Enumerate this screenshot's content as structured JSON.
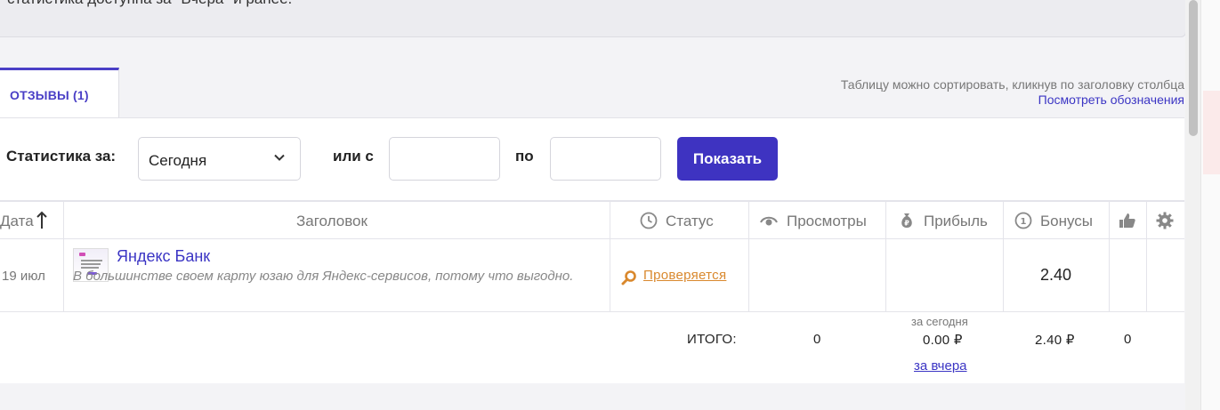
{
  "notice": {
    "text": "статистика доступна за \"Вчера\" и ранее."
  },
  "tabs": [
    {
      "label": "ОТЗЫВЫ (1)"
    }
  ],
  "hint": {
    "sort_text": "Таблицу можно сортировать, кликнув по заголовку столбца",
    "legend_link": "Посмотреть обозначения"
  },
  "filter": {
    "label": "Статистика за:",
    "period_value": "Сегодня",
    "or_from_label": "или с",
    "to_label": "по",
    "date_from_value": "",
    "date_to_value": "",
    "show_button": "Показать"
  },
  "table": {
    "headers": {
      "date": "Дата",
      "title": "Заголовок",
      "status": "Статус",
      "views": "Просмотры",
      "profit": "Прибыль",
      "bonuses": "Бонусы"
    },
    "rows": [
      {
        "date": "19 июл",
        "title": "Яндекс Банк",
        "description": "В большинстве своем карту юзаю для Яндекс-сервисов, потому что выгодно.",
        "status": "Проверяется",
        "views": "",
        "profit": "",
        "bonuses": "2.40"
      }
    ]
  },
  "totals": {
    "label": "ИТОГО:",
    "views": "0",
    "profit_caption": "за сегодня",
    "profit": "0.00 ₽",
    "bonuses": "2.40 ₽",
    "likes": "0",
    "yesterday_link": "за вчера"
  },
  "colors": {
    "accent": "#3e33c1",
    "status": "#d9882d"
  }
}
